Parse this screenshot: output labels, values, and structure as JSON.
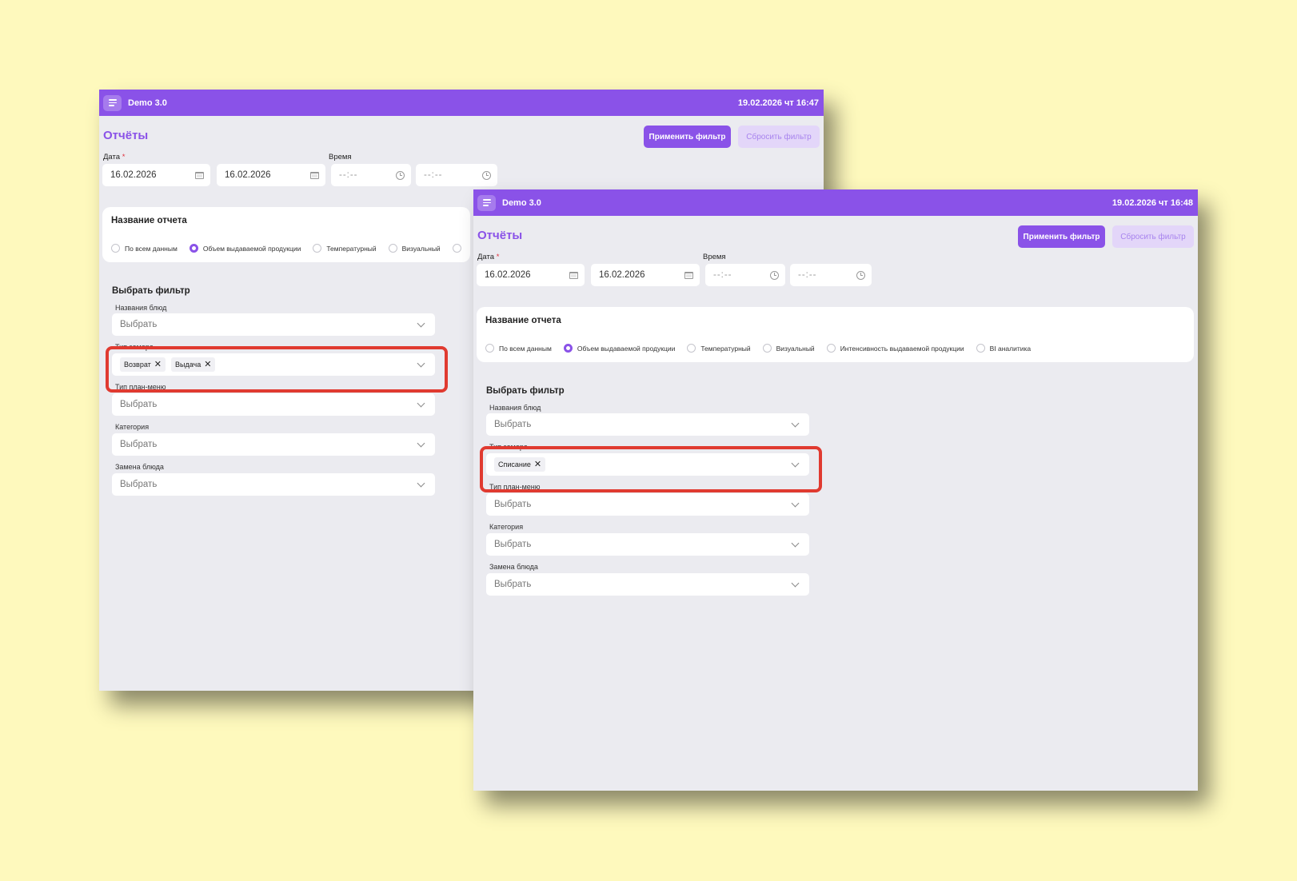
{
  "app_title": "Demo 3.0",
  "page_title": "Отчёты",
  "apply_button": "Применить фильтр",
  "reset_button": "Сбросить фильтр",
  "date_label": "Дата",
  "required_mark": "*",
  "time_label": "Время",
  "report_card_title": "Название отчета",
  "filter_title": "Выбрать фильтр",
  "select_placeholder": "Выбрать",
  "filter_labels": {
    "dish_names": "Названия блюд",
    "measure_type": "Тип замера",
    "plan_menu_type": "Тип план-меню",
    "category": "Категория",
    "dish_replacement": "Замена блюда"
  },
  "colors": {
    "accent": "#8a52e8",
    "highlight": "#e03a30",
    "background": "#fef9bd",
    "panel": "#ebebf0"
  },
  "icons": {
    "menu": "menu-icon",
    "calendar": "calendar-icon",
    "clock": "clock-icon",
    "chevron": "chevron-down-icon",
    "remove": "close-icon"
  },
  "windows": [
    {
      "datetime": "19.02.2026 чт 16:47",
      "date_from": "16.02.2026",
      "date_to": "16.02.2026",
      "time_from": "--:--",
      "time_to": "--:--",
      "report_options": [
        {
          "label": "По всем данным",
          "checked": false
        },
        {
          "label": "Объем выдаваемой продукции",
          "checked": true
        },
        {
          "label": "Температурный",
          "checked": false
        },
        {
          "label": "Визуальный",
          "checked": false
        },
        {
          "label": "",
          "checked": false
        }
      ],
      "measure_type_selected": [
        "Возврат",
        "Выдача"
      ]
    },
    {
      "datetime": "19.02.2026 чт 16:48",
      "date_from": "16.02.2026",
      "date_to": "16.02.2026",
      "time_from": "--:--",
      "time_to": "--:--",
      "report_options": [
        {
          "label": "По всем данным",
          "checked": false
        },
        {
          "label": "Объем выдаваемой продукции",
          "checked": true
        },
        {
          "label": "Температурный",
          "checked": false
        },
        {
          "label": "Визуальный",
          "checked": false
        },
        {
          "label": "Интенсивность выдаваемой продукции",
          "checked": false
        },
        {
          "label": "BI аналитика",
          "checked": false
        }
      ],
      "measure_type_selected": [
        "Списание"
      ]
    }
  ]
}
